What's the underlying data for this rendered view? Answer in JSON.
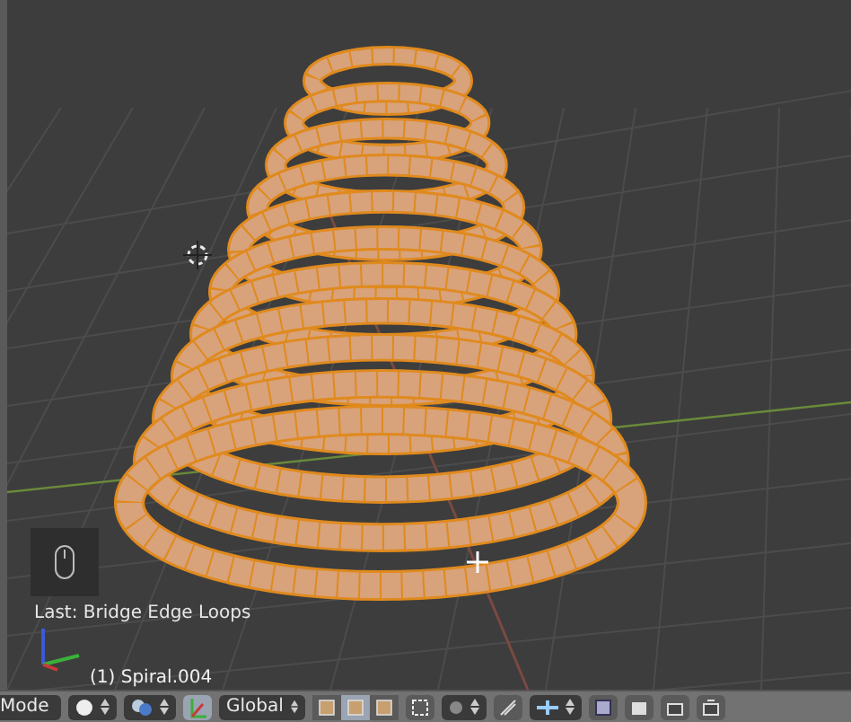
{
  "viewport": {
    "last_operator": "Last: Bridge Edge Loops",
    "object_label": "(1) Spiral.004"
  },
  "header": {
    "mode": "Mode",
    "orientation": "Global",
    "manipulator_on": true,
    "select_modes": [
      {
        "selected": false
      },
      {
        "selected": true
      },
      {
        "selected": false
      }
    ]
  }
}
